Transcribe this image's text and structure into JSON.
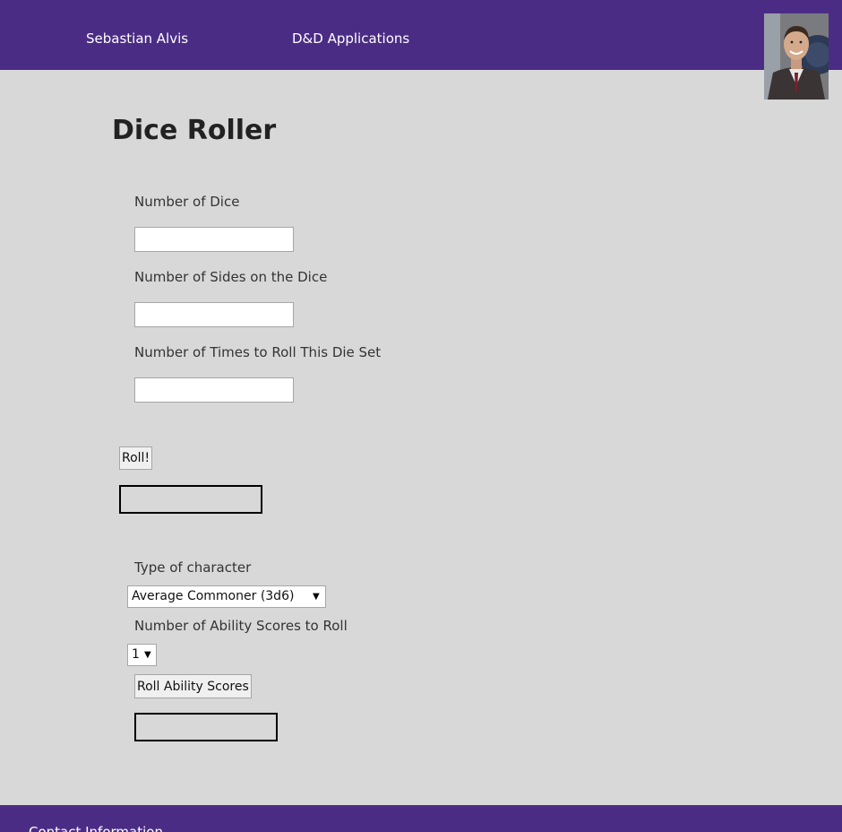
{
  "header": {
    "nav": [
      {
        "label": "Sebastian Alvis"
      },
      {
        "label": "D&D Applications"
      }
    ]
  },
  "main": {
    "title": "Dice Roller",
    "dice_form": {
      "num_dice_label": "Number of Dice",
      "num_dice_value": "",
      "num_sides_label": "Number of Sides on the Dice",
      "num_sides_value": "",
      "num_times_label": "Number of Times to Roll This Die Set",
      "num_times_value": "",
      "roll_button": "Roll!",
      "result": ""
    },
    "ability_form": {
      "type_label": "Type of character",
      "type_selected": "Average Commoner (3d6)",
      "count_label": "Number of Ability Scores to Roll",
      "count_selected": "1",
      "roll_button": "Roll Ability Scores",
      "result": ""
    }
  },
  "footer": {
    "text": "Contact Information"
  },
  "colors": {
    "brand": "#4b2c85",
    "background": "#d8d8d8"
  }
}
